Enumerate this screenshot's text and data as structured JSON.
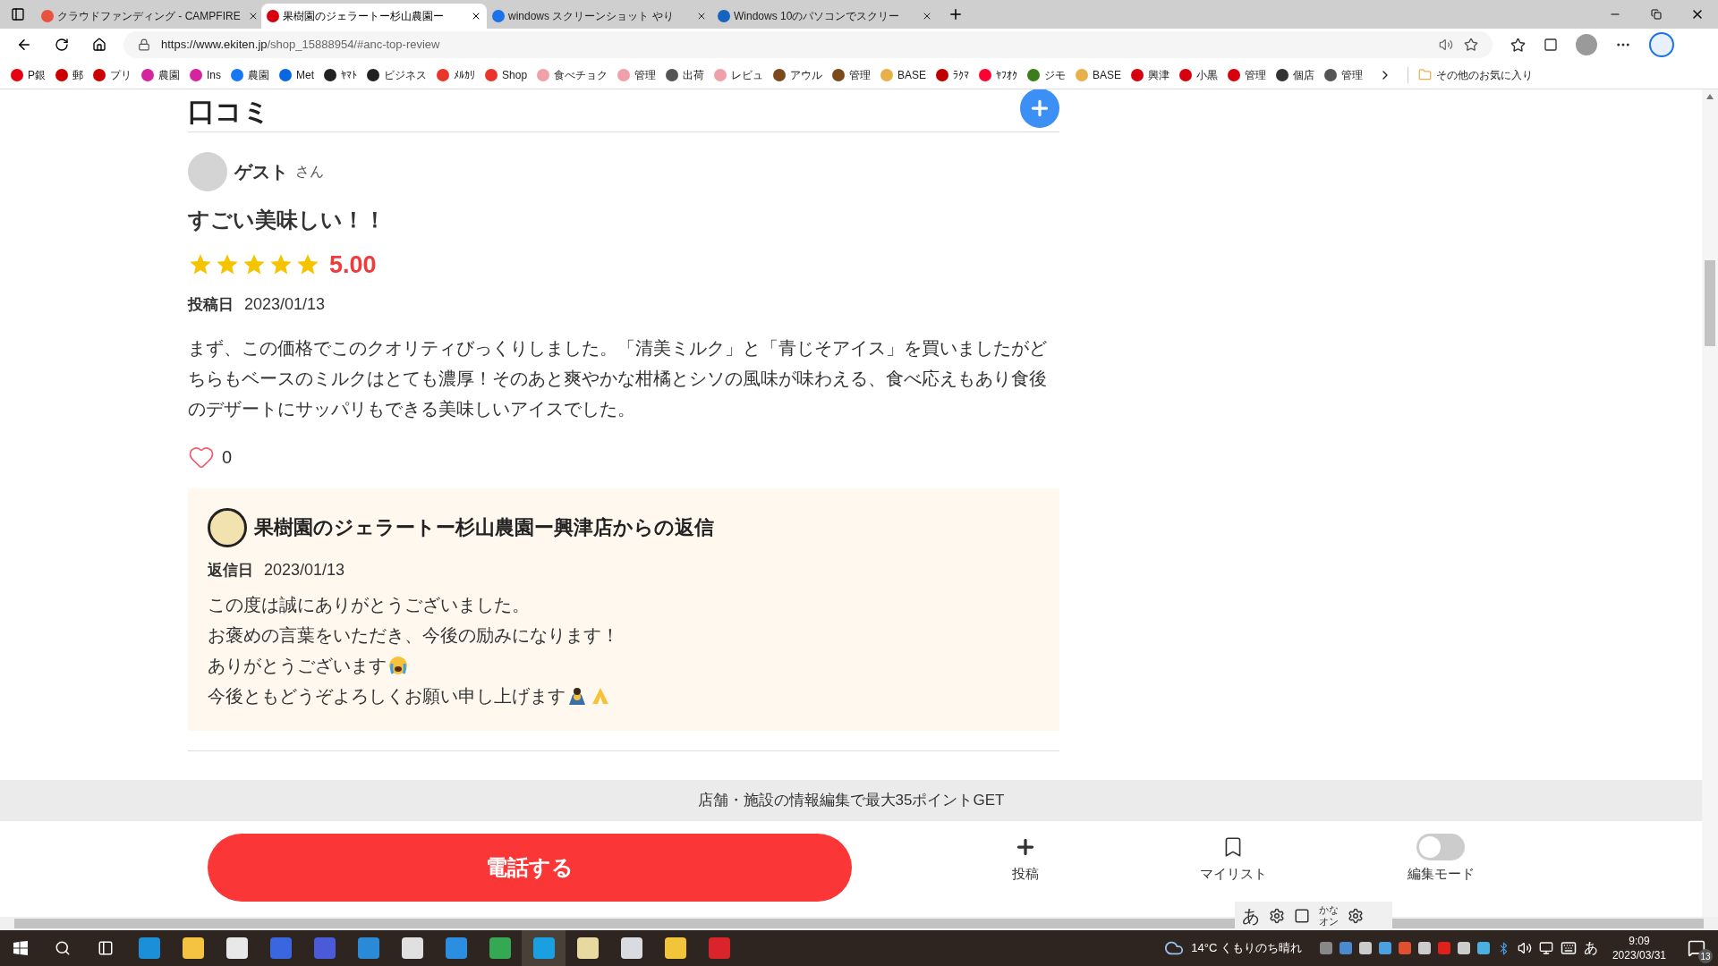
{
  "browser": {
    "tabs": [
      {
        "title": "クラウドファンディング - CAMPFIRE",
        "selected": false,
        "color": "#e8533f"
      },
      {
        "title": "果樹園のジェラートー杉山農園ー",
        "selected": true,
        "color": "#d7000f"
      },
      {
        "title": "windows スクリーンショット やり",
        "selected": false,
        "color": "#1a73e8"
      },
      {
        "title": "Windows 10のパソコンでスクリー",
        "selected": false,
        "color": "#1565c0"
      }
    ],
    "url_host": "https://www.ekiten.jp",
    "url_path": "/shop_15888954/#anc-top-review",
    "bookmarks": [
      {
        "label": "P銀",
        "color": "#e60012"
      },
      {
        "label": "郵",
        "color": "#cc0000"
      },
      {
        "label": "プリ",
        "color": "#cc0000"
      },
      {
        "label": "農園",
        "color": "#d6249f"
      },
      {
        "label": "Ins",
        "color": "#d6249f"
      },
      {
        "label": "農園",
        "color": "#1877f2"
      },
      {
        "label": "Met",
        "color": "#0668e1"
      },
      {
        "label": "ﾔﾏﾄ",
        "color": "#222222"
      },
      {
        "label": "ビジネス",
        "color": "#222222"
      },
      {
        "label": "ﾒﾙｶﾘ",
        "color": "#ea352d"
      },
      {
        "label": "Shop",
        "color": "#ea352d"
      },
      {
        "label": "食べチョク",
        "color": "#f0a0a8"
      },
      {
        "label": "管理",
        "color": "#f0a0a8"
      },
      {
        "label": "出荷",
        "color": "#555555"
      },
      {
        "label": "レビュ",
        "color": "#f0a0a8"
      },
      {
        "label": "アウル",
        "color": "#7a4a1a"
      },
      {
        "label": "管理",
        "color": "#7a4a1a"
      },
      {
        "label": "BASE",
        "color": "#e8b04a"
      },
      {
        "label": "ﾗｸﾏ",
        "color": "#bf0000"
      },
      {
        "label": "ﾔﾌｵｸ",
        "color": "#ff0033"
      },
      {
        "label": "ジモ",
        "color": "#3a7d1a"
      },
      {
        "label": "BASE",
        "color": "#e8b04a"
      },
      {
        "label": "興津",
        "color": "#d7000f"
      },
      {
        "label": "小黒",
        "color": "#d7000f"
      },
      {
        "label": "管理",
        "color": "#d7000f"
      },
      {
        "label": "個店",
        "color": "#333333"
      },
      {
        "label": "管理",
        "color": "#555555"
      }
    ],
    "other_favorites": "その他のお気に入り"
  },
  "page": {
    "section_title": "口コミ",
    "review": {
      "user": "ゲスト",
      "user_suffix": "さん",
      "title": "すごい美味しい！！",
      "stars": 5,
      "rating": "5.00",
      "date_label": "投稿日",
      "date": "2023/01/13",
      "body": "まず、この価格でこのクオリティびっくりしました。「清美ミルク」と「青じそアイス」を買いましたがどちらもベースのミルクはとても濃厚！そのあと爽やかな柑橘とシソの風味が味わえる、食べ応えもあり食後のデザートにサッパリもできる美味しいアイスでした。",
      "liked": false,
      "likes": "0"
    },
    "reply": {
      "title": "果樹園のジェラートー杉山農園ー興津店からの返信",
      "date_label": "返信日",
      "date": "2023/01/13",
      "lines": [
        {
          "text": "この度は誠にありがとうございました。",
          "kind": "plain"
        },
        {
          "text": "お褒めの言葉をいただき、今後の励みになります！",
          "kind": "plain"
        },
        {
          "text": "ありがとうございます",
          "kind": "crying"
        },
        {
          "text": "今後ともどうぞよろしくお願い申し上げます",
          "kind": "bowing"
        }
      ]
    },
    "banner": "店舗・施設の情報編集で最大35ポイントGET",
    "call_button": "電話する",
    "actions": [
      {
        "label": "投稿",
        "kind": "plus"
      },
      {
        "label": "マイリスト",
        "kind": "bookmark"
      },
      {
        "label": "編集モード",
        "kind": "toggle",
        "on": false
      }
    ]
  },
  "ime": {
    "mode": "あ",
    "kana": "かな",
    "kana_state": "オン"
  },
  "taskbar": {
    "weather": "14°C くもりのち晴れ",
    "ime": "あ",
    "time": "9:09",
    "date": "2023/03/31",
    "notifications": "13"
  }
}
